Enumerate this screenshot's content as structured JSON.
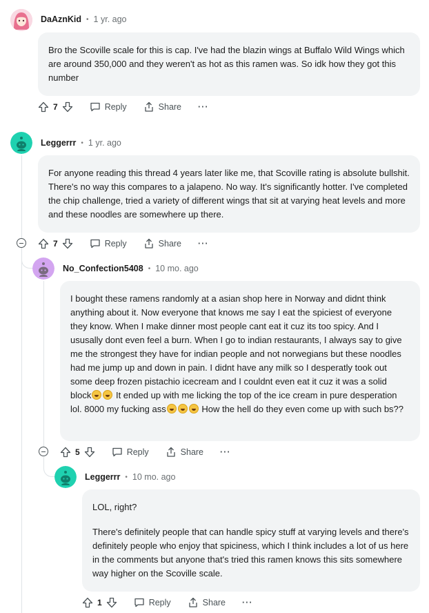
{
  "comments": [
    {
      "author": "DaAznKid",
      "age": "1 yr. ago",
      "avatar": "anime-girl-avatar",
      "text": [
        "Bro the Scoville scale for this is cap. I've had the blazin wings at Buffalo Wild Wings which are around 350,000 and they weren't as hot as this ramen was. So idk how they got this number"
      ],
      "score": "7"
    },
    {
      "author": "Leggerrr",
      "age": "1 yr. ago",
      "avatar": "teal-snoo-avatar",
      "text": [
        "For anyone reading this thread 4 years later like me, that Scoville rating is absolute bullshit. There's no way this compares to a jalapeno. No way. It's significantly hotter. I've completed the chip challenge, tried a variety of different wings that sit at varying heat levels and more and these noodles are somewhere up there."
      ],
      "score": "7"
    },
    {
      "author": "No_Confection5408",
      "age": "10 mo. ago",
      "avatar": "purple-snoo-avatar",
      "text_part1": "I bought these ramens randomly at a asian shop here in Norway and didnt think anything about it. Now everyone that knows me say I eat the spiciest of everyone they know. When I make dinner most people cant eat it cuz its too spicy. And I ususally dont even feel a burn. When I go to indian restaurants, I always say to give me the strongest they have for indian people and not norwegians but these noodles had me jump up and down in pain. I didnt have any milk so I desperatly took out some deep frozen pistachio icecream and I couldnt even eat it cuz it was a solid block",
      "text_part2": " It ended up with me licking the top of the ice cream in pure desperation lol. 8000 my fucking ass",
      "text_part3": " How the hell do they even come up with such bs??",
      "score": "5"
    },
    {
      "author": "Leggerrr",
      "age": "10 mo. ago",
      "avatar": "teal-snoo-avatar",
      "text": [
        "LOL, right?",
        "There's definitely people that can handle spicy stuff at varying levels and there's definitely people who enjoy that spiciness, which I think includes a lot of us here in the comments but anyone that's tried this ramen knows this sits somewhere way higher on the Scoville scale."
      ],
      "score": "1"
    }
  ],
  "labels": {
    "reply": "Reply",
    "share": "Share",
    "more": "···",
    "dot": "•"
  },
  "colors": {
    "teal_avatar": "#1fd1b0",
    "purple_avatar": "#d3a5f0",
    "bubble": "#f2f4f5"
  }
}
